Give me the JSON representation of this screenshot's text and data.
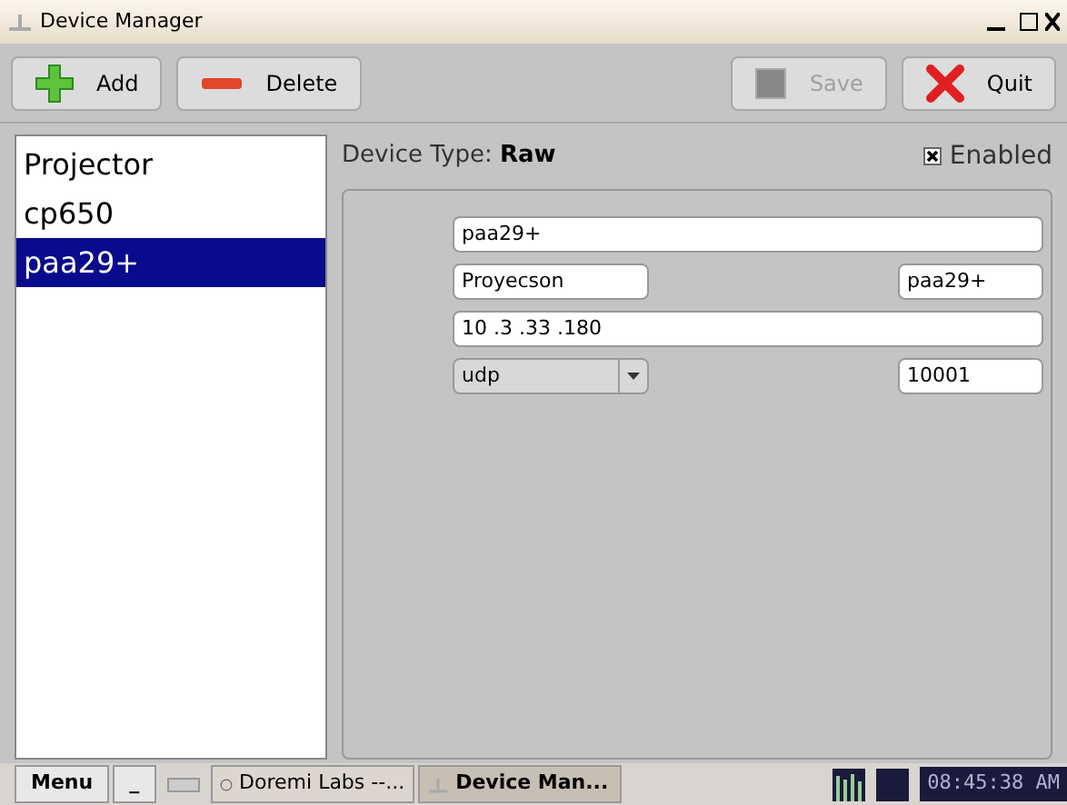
{
  "window": {
    "title": "Device Manager"
  },
  "toolbar": [
    {
      "label": "Add",
      "kind": "add",
      "disabled": false
    },
    {
      "label": "Delete",
      "kind": "delete",
      "disabled": false
    },
    {
      "label": "Save",
      "kind": "save",
      "disabled": true
    },
    {
      "label": "Quit",
      "kind": "quit",
      "disabled": false
    }
  ],
  "devices": [
    {
      "label": "Projector",
      "selected": false
    },
    {
      "label": "cp650",
      "selected": false
    },
    {
      "label": "paa29+",
      "selected": true
    }
  ],
  "device_type": {
    "label": "Device Type:",
    "value": "Raw"
  },
  "enabled": {
    "label": "Enabled",
    "checked": true
  },
  "form": {
    "name": "paa29+",
    "manufacturer": "Proyecson",
    "model": "paa29+",
    "address": "10 .3 .33 .180",
    "protocol": "udp",
    "port": "10001"
  },
  "taskbar": {
    "menu": "Menu",
    "minimize": "_",
    "tasks": [
      {
        "label": "Doremi Labs --...",
        "selected": false
      },
      {
        "label": "Device Man...",
        "selected": true
      }
    ],
    "clock": "08:45:38 AM"
  }
}
